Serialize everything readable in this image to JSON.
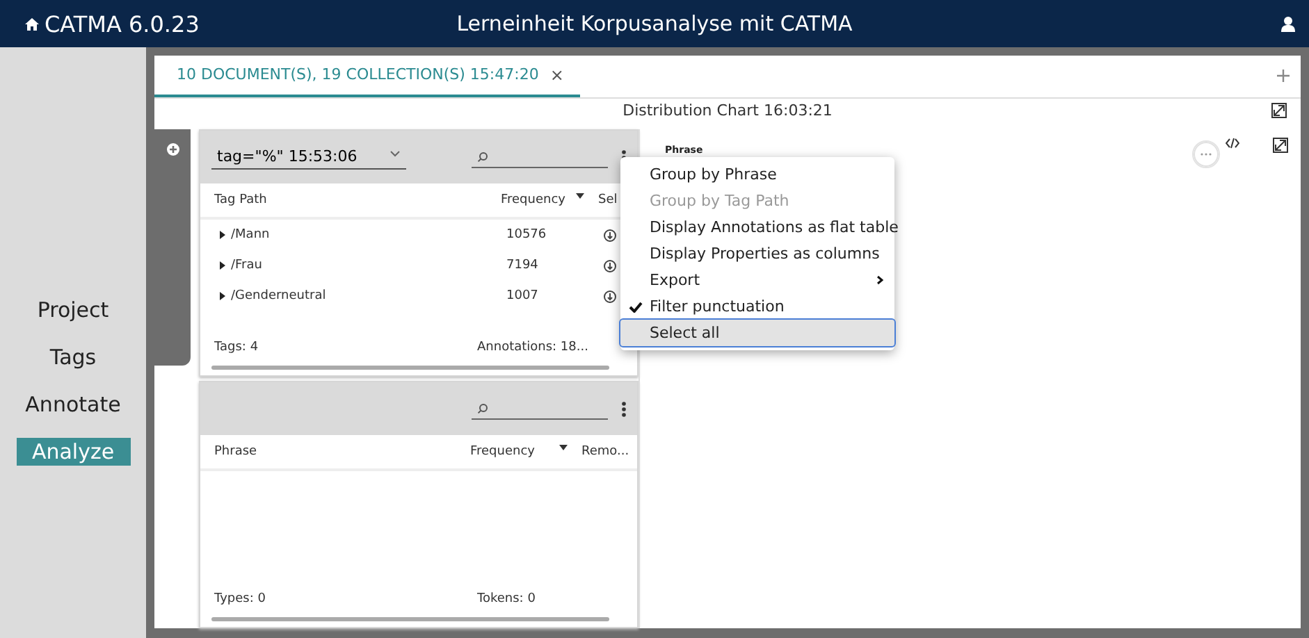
{
  "app_bar": {
    "title": "CATMA 6.0.23",
    "project": "Lerneinheit Korpusanalyse mit CATMA"
  },
  "sidebar": {
    "items": [
      {
        "label": "Project",
        "selected": false
      },
      {
        "label": "Tags",
        "selected": false
      },
      {
        "label": "Annotate",
        "selected": false
      },
      {
        "label": "Analyze",
        "selected": true
      }
    ]
  },
  "tabs": [
    {
      "label": "10 DOCUMENT(S), 19 COLLECTION(S) 15:47:20",
      "selected": true,
      "close": "×"
    }
  ],
  "view_title": "Distribution Chart 16:03:21",
  "query_panel": {
    "query": "tag=\"%\" 15:53:06",
    "columns": [
      "Tag Path",
      "Frequency",
      "Sel"
    ],
    "rows": [
      {
        "tag": "/Mann",
        "frequency": "10576"
      },
      {
        "tag": "/Frau",
        "frequency": "7194"
      },
      {
        "tag": "/Genderneutral",
        "frequency": "1007"
      }
    ],
    "footer": [
      "Tags: 4",
      "Annotations: 18..."
    ]
  },
  "kwic_panel": {
    "columns": [
      "Phrase",
      "Frequency",
      "Remo..."
    ],
    "footer": [
      "Types: 0",
      "Tokens: 0"
    ]
  },
  "chart": {
    "legend_title": "Phrase"
  },
  "menu": [
    {
      "label": "Group by Phrase",
      "disabled": false,
      "checked": false,
      "submenu": false,
      "selected": false
    },
    {
      "label": "Group by Tag Path",
      "disabled": true,
      "checked": false,
      "submenu": false,
      "selected": false
    },
    {
      "label": "Display Annotations as flat table",
      "disabled": false,
      "checked": false,
      "submenu": false,
      "selected": false
    },
    {
      "label": "Display Properties as columns",
      "disabled": false,
      "checked": false,
      "submenu": false,
      "selected": false
    },
    {
      "label": "Export",
      "disabled": false,
      "checked": false,
      "submenu": true,
      "selected": false
    },
    {
      "label": "Filter punctuation",
      "disabled": false,
      "checked": true,
      "submenu": false,
      "selected": false
    },
    {
      "label": "Select all",
      "disabled": false,
      "checked": false,
      "submenu": false,
      "selected": true
    }
  ]
}
